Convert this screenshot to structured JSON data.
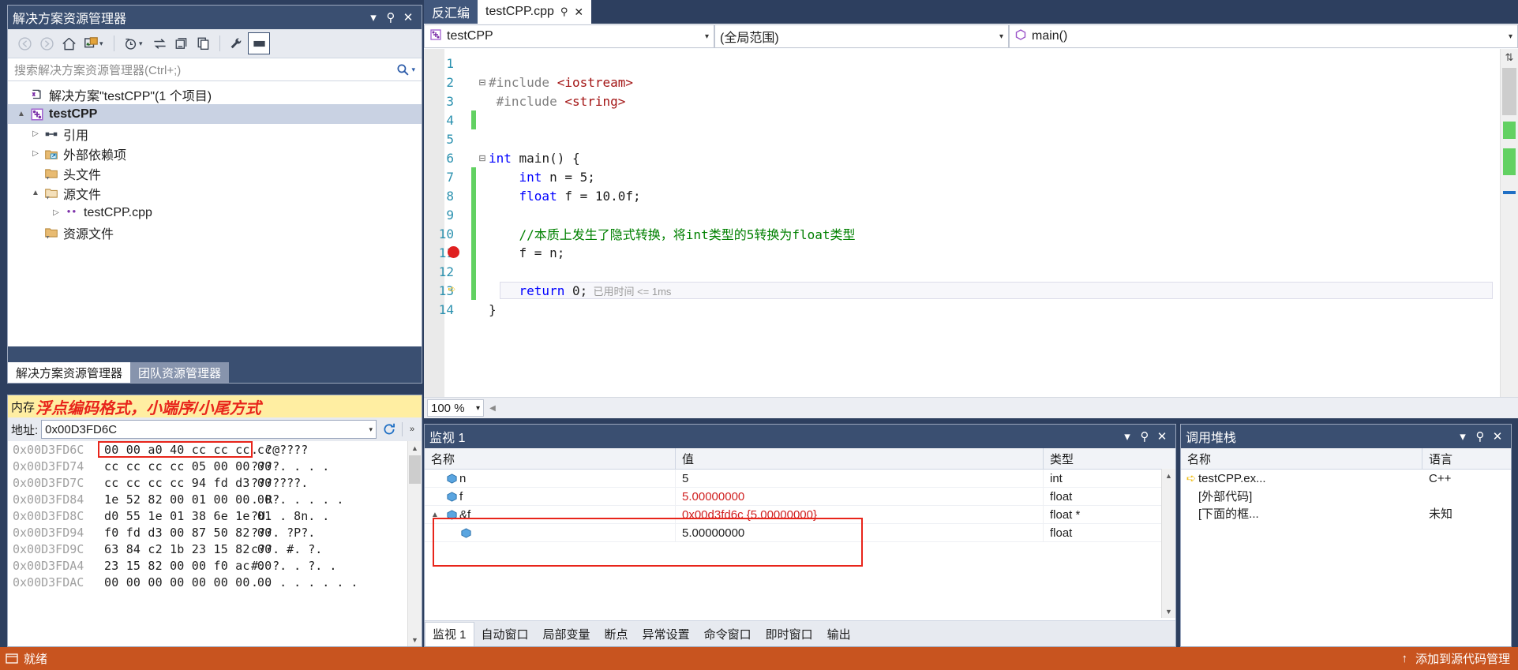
{
  "solution_explorer": {
    "title": "解决方案资源管理器",
    "window_buttons": [
      "▾",
      "⚲",
      "✕"
    ],
    "toolbar_icons": [
      "back-arrow-icon",
      "forward-arrow-icon",
      "home-icon",
      "collapse-all-icon",
      "pending-changes-icon",
      "sync-icon",
      "show-all-files-icon",
      "copy-icon",
      "properties-icon",
      "preview-selected-icon"
    ],
    "search_placeholder": "搜索解决方案资源管理器(Ctrl+;)",
    "tree": [
      {
        "label": "解决方案\"testCPP\"(1 个项目)",
        "icon": "solution-icon",
        "expander": "",
        "indent": 0,
        "selected": false,
        "bold": false
      },
      {
        "label": "testCPP",
        "icon": "cpp-project-icon",
        "expander": "▲",
        "indent": 0,
        "selected": true,
        "bold": true
      },
      {
        "label": "引用",
        "icon": "references-icon",
        "expander": "▷",
        "indent": 1,
        "selected": false,
        "bold": false
      },
      {
        "label": "外部依赖项",
        "icon": "external-deps-icon",
        "expander": "▷",
        "indent": 1,
        "selected": false,
        "bold": false
      },
      {
        "label": "头文件",
        "icon": "filter-folder-icon",
        "expander": "",
        "indent": 1,
        "selected": false,
        "bold": false
      },
      {
        "label": "源文件",
        "icon": "filter-folder-open-icon",
        "expander": "▲",
        "indent": 1,
        "selected": false,
        "bold": false
      },
      {
        "label": "testCPP.cpp",
        "icon": "cpp-file-icon",
        "expander": "▷",
        "indent": 2,
        "selected": false,
        "bold": false
      },
      {
        "label": "资源文件",
        "icon": "filter-folder-icon",
        "expander": "",
        "indent": 1,
        "selected": false,
        "bold": false
      }
    ],
    "bottom_tabs": [
      {
        "label": "解决方案资源管理器",
        "active": true
      },
      {
        "label": "团队资源管理器",
        "active": false
      }
    ]
  },
  "memory": {
    "title": "内存",
    "annotation": "浮点编码格式，小端序/小尾方式",
    "address_label": "地址:",
    "address_value": "0x00D3FD6C",
    "refresh_icon": "refresh-icon",
    "rows": [
      {
        "address": "0x00D3FD6C",
        "hex": "00 00 a0 40 cc cc cc cc",
        "ascii": ". ?@????"
      },
      {
        "address": "0x00D3FD74",
        "hex": "cc cc cc cc 05 00 00 00",
        "ascii": "????. . . ."
      },
      {
        "address": "0x00D3FD7C",
        "hex": "cc cc cc cc 94 fd d3 00",
        "ascii": "???????."
      },
      {
        "address": "0x00D3FD84",
        "hex": "1e 52 82 00 01 00 00 00",
        "ascii": ". R?. . . . ."
      },
      {
        "address": "0x00D3FD8C",
        "hex": "d0 55 1e 01 38 6e 1e 01",
        "ascii": "?U. . 8n. ."
      },
      {
        "address": "0x00D3FD94",
        "hex": "f0 fd d3 00 87 50 82 00",
        "ascii": "???. ?P?."
      },
      {
        "address": "0x00D3FD9C",
        "hex": "63 84 c2 1b 23 15 82 00",
        "ascii": "c??. #. ?."
      },
      {
        "address": "0x00D3FDA4",
        "hex": "23 15 82 00 00 f0 ac 00",
        "ascii": "#. ?. . ?. ."
      },
      {
        "address": "0x00D3FDAC",
        "hex": "00 00 00 00 00 00 00 00",
        "ascii": ". . . . . . . ."
      }
    ],
    "highlight_color": "#e8251b"
  },
  "editor": {
    "tabs": [
      {
        "label": "反汇编",
        "active": false,
        "closable": false,
        "pinnable": false
      },
      {
        "label": "testCPP.cpp",
        "active": true,
        "closable": true,
        "pinnable": true
      }
    ],
    "nav_project": "testCPP",
    "nav_scope": "(全局范围)",
    "nav_member": "main()",
    "zoom": "100 %",
    "lines": [
      {
        "num": "1",
        "fold": "",
        "change": false,
        "marker": "",
        "tokens": []
      },
      {
        "num": "2",
        "fold": "−",
        "change": false,
        "marker": "",
        "tokens": [
          {
            "t": "#include ",
            "c": "k-gray"
          },
          {
            "t": "<iostream>",
            "c": "k-red"
          }
        ]
      },
      {
        "num": "3",
        "fold": "",
        "change": false,
        "marker": "",
        "tokens": [
          {
            "t": " #include ",
            "c": "k-gray"
          },
          {
            "t": "<string>",
            "c": "k-red"
          }
        ]
      },
      {
        "num": "4",
        "fold": "",
        "change": true,
        "marker": "",
        "tokens": []
      },
      {
        "num": "5",
        "fold": "",
        "change": false,
        "marker": "",
        "tokens": []
      },
      {
        "num": "6",
        "fold": "−",
        "change": false,
        "marker": "",
        "tokens": [
          {
            "t": "int",
            "c": "k-blue"
          },
          {
            "t": " main() {",
            "c": "k-black"
          }
        ]
      },
      {
        "num": "7",
        "fold": "",
        "change": true,
        "marker": "",
        "tokens": [
          {
            "t": "    ",
            "c": "k-black"
          },
          {
            "t": "int",
            "c": "k-blue"
          },
          {
            "t": " n = 5;",
            "c": "k-black"
          }
        ]
      },
      {
        "num": "8",
        "fold": "",
        "change": true,
        "marker": "",
        "tokens": [
          {
            "t": "    ",
            "c": "k-black"
          },
          {
            "t": "float",
            "c": "k-blue"
          },
          {
            "t": " f = 10.0f;",
            "c": "k-black"
          }
        ]
      },
      {
        "num": "9",
        "fold": "",
        "change": true,
        "marker": "",
        "tokens": []
      },
      {
        "num": "10",
        "fold": "",
        "change": true,
        "marker": "",
        "tokens": [
          {
            "t": "    //本质上发生了隐式转换，将int类型的5转换为float类型",
            "c": "k-green"
          }
        ]
      },
      {
        "num": "11",
        "fold": "",
        "change": true,
        "marker": "breakpoint",
        "tokens": [
          {
            "t": "    f = n;",
            "c": "k-black"
          }
        ]
      },
      {
        "num": "12",
        "fold": "",
        "change": true,
        "marker": "",
        "tokens": []
      },
      {
        "num": "13",
        "fold": "",
        "change": true,
        "marker": "current",
        "tokens": [
          {
            "t": "    ",
            "c": "k-black"
          },
          {
            "t": "return",
            "c": "k-blue"
          },
          {
            "t": " 0;",
            "c": "k-black"
          },
          {
            "t": "  已用时间 <= 1ms",
            "c": "k-dim"
          }
        ]
      },
      {
        "num": "14",
        "fold": "",
        "change": false,
        "marker": "",
        "tokens": [
          {
            "t": "}",
            "c": "k-black"
          }
        ]
      }
    ]
  },
  "watch": {
    "title": "监视 1",
    "window_buttons": [
      "▾",
      "⚲",
      "✕"
    ],
    "columns": [
      "名称",
      "值",
      "类型"
    ],
    "rows": [
      {
        "expander": "",
        "icon": "variable-icon",
        "name": "n",
        "value": "5",
        "value_red": false,
        "type": "int"
      },
      {
        "expander": "",
        "icon": "variable-icon",
        "name": "f",
        "value": "5.00000000",
        "value_red": true,
        "type": "float"
      },
      {
        "expander": "▲",
        "icon": "variable-icon",
        "name": "&f",
        "value": "0x00d3fd6c {5.00000000}",
        "value_red": true,
        "type": "float *"
      },
      {
        "expander": "",
        "icon": "variable-icon",
        "name": "",
        "value": "5.00000000",
        "value_red": false,
        "type": "float"
      }
    ],
    "tabs": [
      {
        "label": "监视 1",
        "active": true
      },
      {
        "label": "自动窗口",
        "active": false
      },
      {
        "label": "局部变量",
        "active": false
      },
      {
        "label": "断点",
        "active": false
      },
      {
        "label": "异常设置",
        "active": false
      },
      {
        "label": "命令窗口",
        "active": false
      },
      {
        "label": "即时窗口",
        "active": false
      },
      {
        "label": "输出",
        "active": false
      }
    ],
    "highlight_color": "#e8251b"
  },
  "call_stack": {
    "title": "调用堆栈",
    "window_buttons": [
      "▾",
      "⚲",
      "✕"
    ],
    "columns": [
      "名称",
      "语言"
    ],
    "rows": [
      {
        "arrow": "➪",
        "name": "testCPP.ex...",
        "lang": "C++"
      },
      {
        "arrow": "",
        "name": "[外部代码]",
        "lang": ""
      },
      {
        "arrow": "",
        "name": "[下面的框...",
        "lang": "未知"
      }
    ]
  },
  "status_bar": {
    "icon": "ready-icon",
    "text": "就绪",
    "right_items": [
      "↑",
      "添加到源代码管理"
    ]
  }
}
